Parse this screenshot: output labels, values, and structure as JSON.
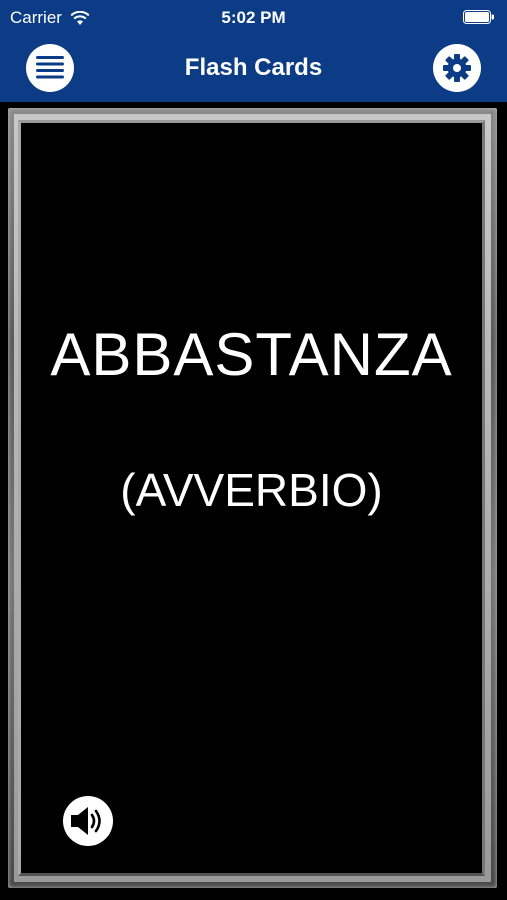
{
  "status_bar": {
    "carrier": "Carrier",
    "time": "5:02 PM"
  },
  "nav": {
    "title": "Flash Cards",
    "menu_icon": "menu-icon",
    "settings_icon": "gear-icon"
  },
  "card": {
    "word": "ABBASTANZA",
    "part_of_speech": "(AVVERBIO)",
    "audio_icon": "speaker-icon"
  },
  "colors": {
    "header": "#0c3c86",
    "card_background": "#000000",
    "text": "#ffffff"
  }
}
